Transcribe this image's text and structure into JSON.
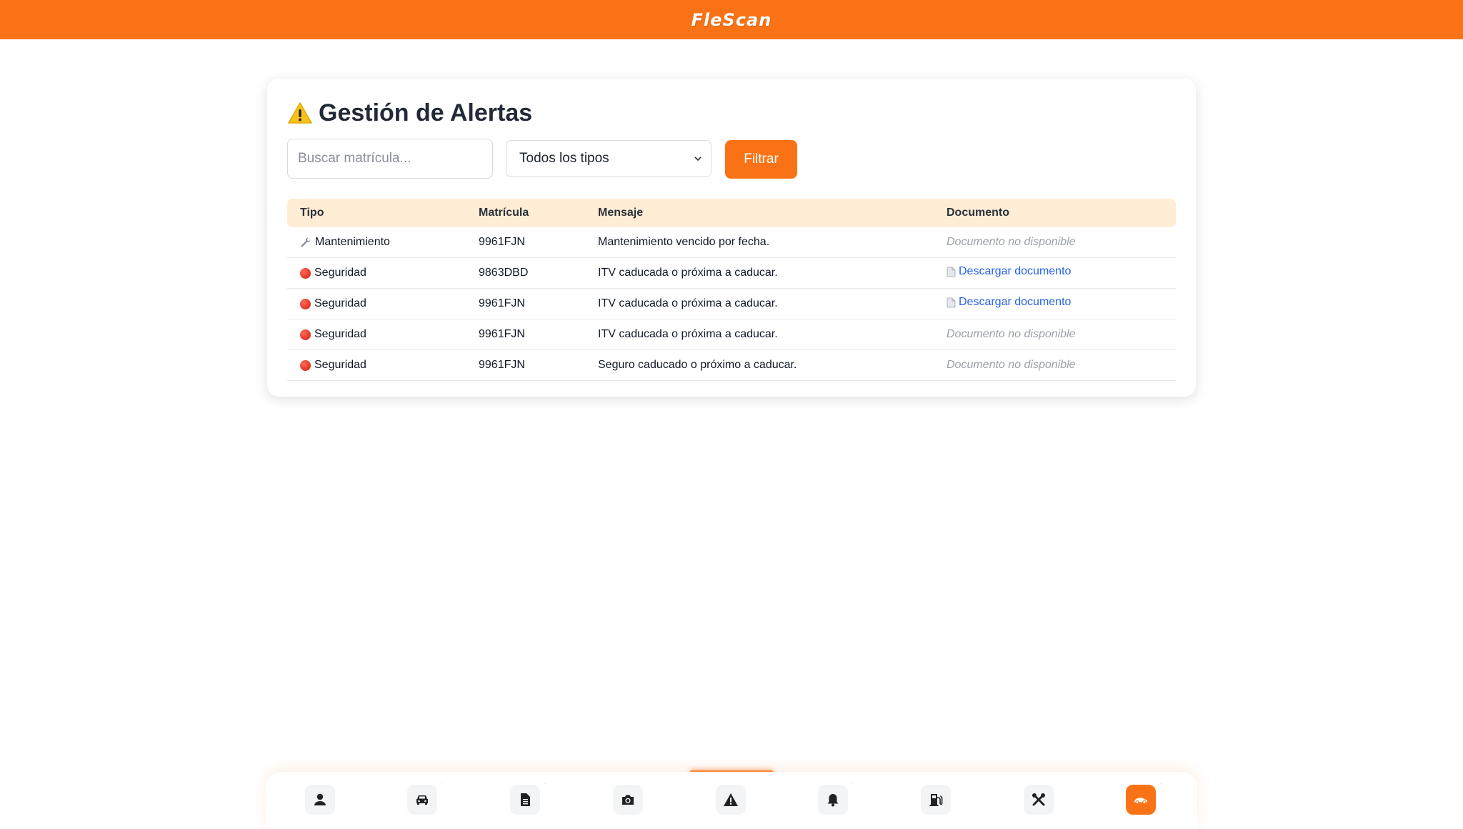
{
  "app": {
    "brand": "FleScan"
  },
  "page": {
    "title": "Gestión de Alertas",
    "title_icon": "warning-icon"
  },
  "filters": {
    "search_placeholder": "Buscar matrícula...",
    "type_select_value": "Todos los tipos",
    "filter_button_label": "Filtrar"
  },
  "table": {
    "headers": [
      "Tipo",
      "Matrícula",
      "Mensaje",
      "Documento"
    ],
    "rows": [
      {
        "type": "Mantenimiento",
        "type_icon": "wrench-icon",
        "plate": "9961FJN",
        "message": "Mantenimiento vencido por fecha.",
        "document": "Documento no disponible",
        "has_doc": false
      },
      {
        "type": "Seguridad",
        "type_icon": "red-circle-icon",
        "plate": "9863DBD",
        "message": "ITV caducada o próxima a caducar.",
        "document": "Descargar documento",
        "has_doc": true
      },
      {
        "type": "Seguridad",
        "type_icon": "red-circle-icon",
        "plate": "9961FJN",
        "message": "ITV caducada o próxima a caducar.",
        "document": "Descargar documento",
        "has_doc": true
      },
      {
        "type": "Seguridad",
        "type_icon": "red-circle-icon",
        "plate": "9961FJN",
        "message": "ITV caducada o próxima a caducar.",
        "document": "Documento no disponible",
        "has_doc": false
      },
      {
        "type": "Seguridad",
        "type_icon": "red-circle-icon",
        "plate": "9961FJN",
        "message": "Seguro caducado o próximo a caducar.",
        "document": "Documento no disponible",
        "has_doc": false
      }
    ]
  },
  "bottom_nav": {
    "items": [
      {
        "icon": "user-icon",
        "active": false
      },
      {
        "icon": "car-icon",
        "active": false
      },
      {
        "icon": "document-icon",
        "active": false
      },
      {
        "icon": "camera-icon",
        "active": false
      },
      {
        "icon": "warning-icon",
        "active": false
      },
      {
        "icon": "bell-icon",
        "active": false
      },
      {
        "icon": "fuel-pump-icon",
        "active": false
      },
      {
        "icon": "tools-icon",
        "active": false
      },
      {
        "icon": "car-side-icon",
        "active": true
      }
    ]
  },
  "colors": {
    "accent": "#f97316",
    "header_row": "#ffedd5",
    "link": "#2563eb"
  }
}
